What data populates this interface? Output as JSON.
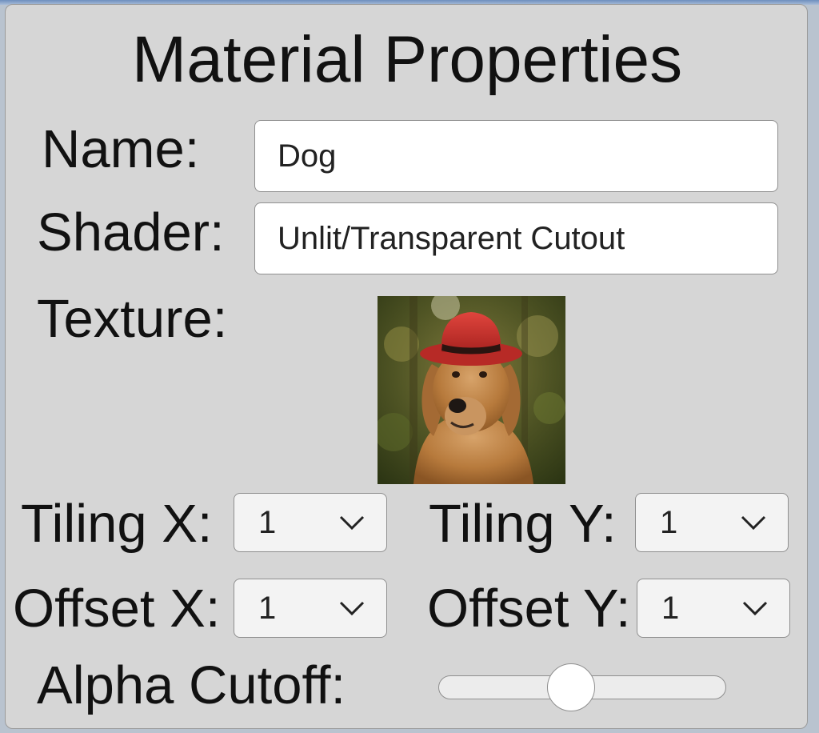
{
  "panel": {
    "title": "Material Properties"
  },
  "name_field": {
    "label": "Name:",
    "value": "Dog"
  },
  "shader_field": {
    "label": "Shader:",
    "value": "Unlit/Transparent Cutout"
  },
  "texture": {
    "label": "Texture:",
    "thumbnail": "golden-retriever-wearing-red-hat"
  },
  "tiling_x": {
    "label": "Tiling X:",
    "value": "1"
  },
  "tiling_y": {
    "label": "Tiling Y:",
    "value": "1"
  },
  "offset_x": {
    "label": "Offset X:",
    "value": "1"
  },
  "offset_y": {
    "label": "Offset Y:",
    "value": "1"
  },
  "alpha_cutoff": {
    "label": "Alpha Cutoff:",
    "value": 0.46
  },
  "colors": {
    "panel_bg": "#d6d6d6",
    "field_bg": "#ffffff",
    "hat_red": "#c8302d"
  }
}
